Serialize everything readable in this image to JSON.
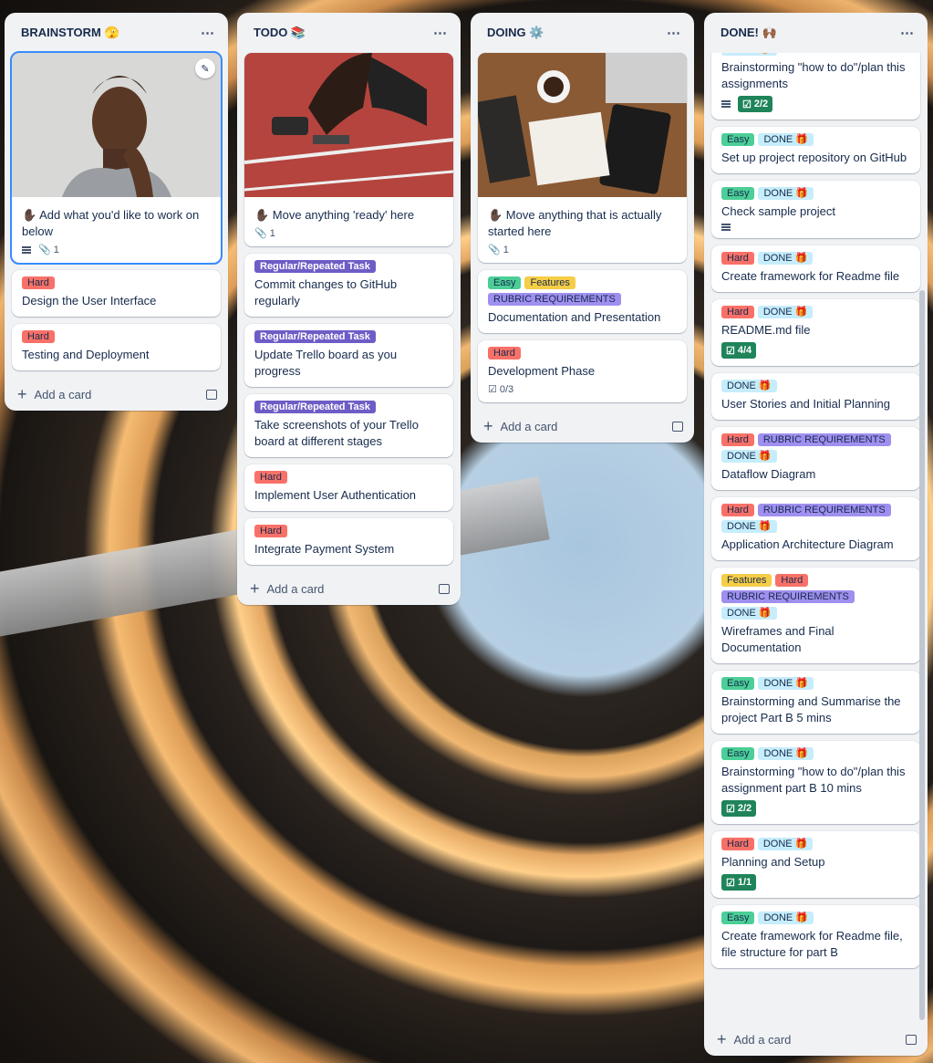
{
  "lists": [
    {
      "title": "BRAINSTORM 🫣",
      "cards": [
        {
          "cover": "portrait",
          "title": "✋🏿 Add what you'd like to work on below",
          "attach": "1",
          "desc": true,
          "labels": []
        },
        {
          "labels": [
            "Hard"
          ],
          "title": "Design the User Interface"
        },
        {
          "labels": [
            "Hard"
          ],
          "title": "Testing and Deployment"
        }
      ]
    },
    {
      "title": "TODO 📚",
      "cards": [
        {
          "cover": "runner",
          "title": "✋🏿 Move anything 'ready' here",
          "attach": "1",
          "labels": []
        },
        {
          "labels": [
            "Regular/Repeated Task"
          ],
          "title": "Commit changes to GitHub regularly"
        },
        {
          "labels": [
            "Regular/Repeated Task"
          ],
          "title": "Update Trello board as you progress"
        },
        {
          "labels": [
            "Regular/Repeated Task"
          ],
          "title": "Take screenshots of your Trello board at different stages"
        },
        {
          "labels": [
            "Hard"
          ],
          "title": "Implement User Authentication"
        },
        {
          "labels": [
            "Hard"
          ],
          "title": "Integrate Payment System"
        }
      ]
    },
    {
      "title": "DOING ⚙️",
      "cards": [
        {
          "cover": "desk",
          "title": "✋🏿 Move anything that is actually started here",
          "attach": "1",
          "labels": []
        },
        {
          "labels": [
            "Easy",
            "Features",
            "RUBRIC REQUIREMENTS"
          ],
          "title": "Documentation and Presentation"
        },
        {
          "labels": [
            "Hard"
          ],
          "title": "Development Phase",
          "checklist": "0/3"
        }
      ]
    },
    {
      "title": "DONE! 🙌🏾",
      "cards": [
        {
          "labels": [
            "Easy",
            "RUBRIC REQUIREMENTS",
            "DONE 🎁"
          ],
          "title": "Brainstorming \"how to do\"/plan this assignments",
          "desc": true,
          "check": "2/2"
        },
        {
          "labels": [
            "Easy",
            "DONE 🎁"
          ],
          "title": "Set up project repository on GitHub"
        },
        {
          "labels": [
            "Easy",
            "DONE 🎁"
          ],
          "title": "Check sample project",
          "desc": true
        },
        {
          "labels": [
            "Hard",
            "DONE 🎁"
          ],
          "title": "Create framework for Readme file"
        },
        {
          "labels": [
            "Hard",
            "DONE 🎁"
          ],
          "title": "README.md file",
          "check": "4/4"
        },
        {
          "labels": [
            "DONE 🎁"
          ],
          "title": "User Stories and Initial Planning"
        },
        {
          "labels": [
            "Hard",
            "RUBRIC REQUIREMENTS",
            "DONE 🎁"
          ],
          "title": "Dataflow Diagram"
        },
        {
          "labels": [
            "Hard",
            "RUBRIC REQUIREMENTS",
            "DONE 🎁"
          ],
          "title": "Application Architecture Diagram"
        },
        {
          "labels": [
            "Features",
            "Hard",
            "RUBRIC REQUIREMENTS",
            "DONE 🎁"
          ],
          "title": "Wireframes and Final Documentation"
        },
        {
          "labels": [
            "Easy",
            "DONE 🎁"
          ],
          "title": "Brainstorming and Summarise the project Part B 5 mins"
        },
        {
          "labels": [
            "Easy",
            "DONE 🎁"
          ],
          "title": "Brainstorming \"how to do\"/plan this assignment part B 10 mins",
          "check": "2/2"
        },
        {
          "labels": [
            "Hard",
            "DONE 🎁"
          ],
          "title": "Planning and Setup",
          "check": "1/1"
        },
        {
          "labels": [
            "Easy",
            "DONE 🎁"
          ],
          "title": "Create framework for Readme file, file structure for part B"
        }
      ]
    }
  ],
  "add_card_label": "Add a card",
  "more_icon": "⋯"
}
